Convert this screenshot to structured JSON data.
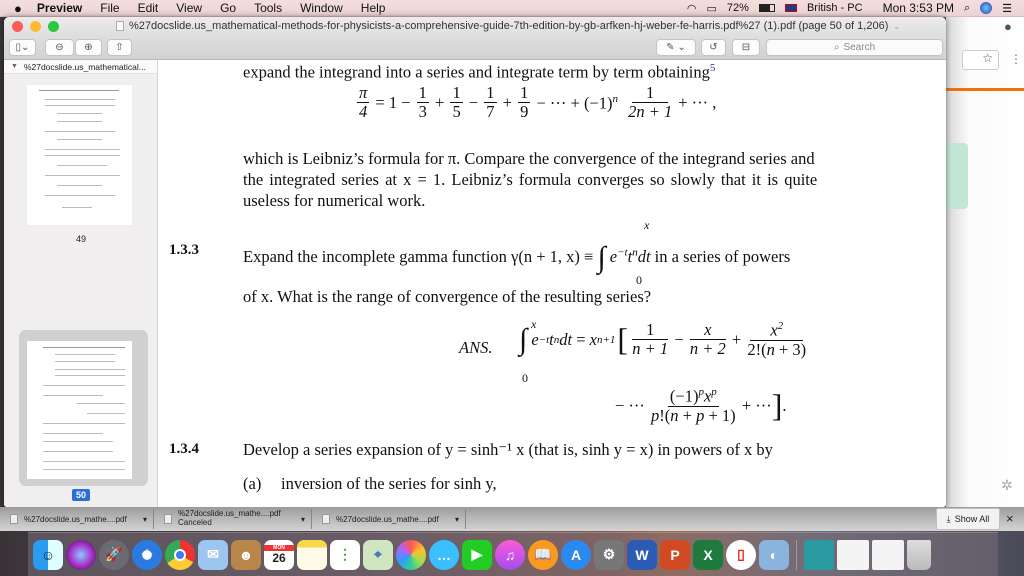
{
  "menubar": {
    "apple": "",
    "app_name": "Preview",
    "items": [
      "File",
      "Edit",
      "View",
      "Go",
      "Tools",
      "Window",
      "Help"
    ],
    "battery": "72%",
    "input_source": "British - PC",
    "clock": "Mon 3:53 PM"
  },
  "window": {
    "title": "%27docslide.us_mathematical-methods-for-physicists-a-comprehensive-guide-7th-edition-by-gb-arfken-hj-weber-fe-harris.pdf%27 (1).pdf (page 50 of 1,206)",
    "search_placeholder": "Search"
  },
  "sidebar": {
    "header": "%27docslide.us_mathematical...",
    "pages": [
      {
        "label": "49",
        "selected": false
      },
      {
        "label": "50",
        "selected": true
      }
    ]
  },
  "document": {
    "line1": "expand the integrand into a series and integrate term by term obtaining",
    "footnote": "5",
    "leibniz": {
      "lhs_num": "π",
      "lhs_den": "4",
      "terms": [
        "1",
        "3",
        "5",
        "7",
        "9"
      ],
      "tail_num": "1",
      "tail_den": "2n + 1"
    },
    "para2": [
      "which is Leibniz’s formula for π. Compare the convergence of the integrand series and",
      "the integrated series at x = 1. Leibniz’s formula converges so slowly that it is quite",
      "useless for numerical work."
    ],
    "ex133": {
      "number": "1.3.3",
      "text_a": "Expand the incomplete gamma function γ(n + 1, x) ≡",
      "text_b": "e",
      "text_c": "in a series of powers",
      "line2": "of x. What is the range of convergence of the resulting series?",
      "ans_label": "ANS.",
      "upper": "x",
      "lower": "0"
    },
    "ex134": {
      "number": "1.3.4",
      "text": "Develop a series expansion of y = sinh⁻¹ x (that is, sinh y = x) in powers of x by",
      "part_a_label": "(a)",
      "part_a": "inversion of the series for sinh y,"
    }
  },
  "downloads": {
    "items": [
      {
        "name": "%27docslide.us_mathe....pdf",
        "status": ""
      },
      {
        "name": "%27docslide.us_mathe....pdf",
        "status": "Canceled"
      },
      {
        "name": "%27docslide.us_mathe....pdf",
        "status": ""
      }
    ],
    "show_all": "Show All",
    "close": "×"
  },
  "dock": {
    "calendar_month": "MON",
    "calendar_day": "26",
    "apps": [
      "Finder",
      "Siri",
      "Launchpad",
      "Safari",
      "Chrome",
      "Mail",
      "Contacts",
      "Calendar",
      "Notes",
      "Reminders",
      "Maps",
      "Photos",
      "Messages",
      "FaceTime",
      "iTunes",
      "iBooks",
      "App Store",
      "System Preferences",
      "Word",
      "PowerPoint",
      "Excel",
      "Office Installer",
      "Preview",
      "Book",
      "Document 1",
      "Document 2",
      "Trash"
    ]
  }
}
